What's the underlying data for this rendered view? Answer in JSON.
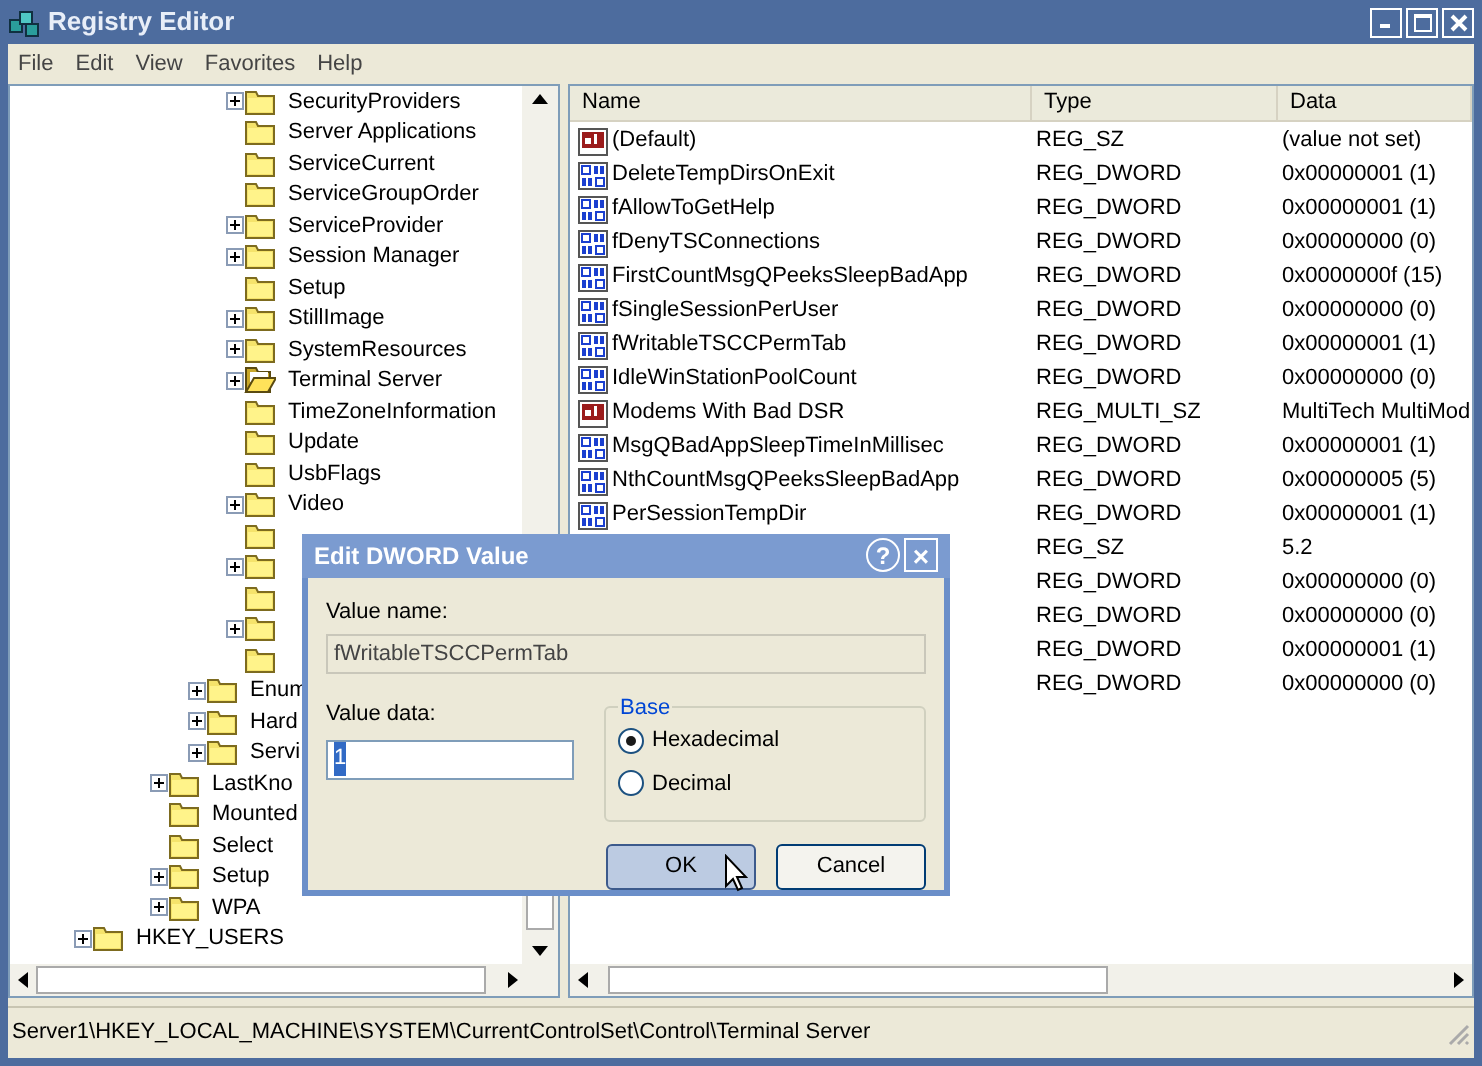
{
  "window": {
    "title": "Registry Editor"
  },
  "menu": [
    "File",
    "Edit",
    "View",
    "Favorites",
    "Help"
  ],
  "tree": [
    {
      "children": [
        {
          "children": [
            {
              "children": [
                {
                  "children": [
                    {
                      "children": [
                        {
                          "label": "SecurityProviders",
                          "expandable": true,
                          "selected": false
                        },
                        {
                          "label": "Server Applications",
                          "expandable": false,
                          "selected": false
                        },
                        {
                          "label": "ServiceCurrent",
                          "expandable": false,
                          "selected": false
                        },
                        {
                          "label": "ServiceGroupOrder",
                          "expandable": false,
                          "selected": false
                        },
                        {
                          "label": "ServiceProvider",
                          "expandable": true,
                          "selected": false
                        },
                        {
                          "label": "Session Manager",
                          "expandable": true,
                          "selected": false
                        },
                        {
                          "label": "Setup",
                          "expandable": false,
                          "selected": false
                        },
                        {
                          "label": "StillImage",
                          "expandable": true,
                          "selected": false
                        },
                        {
                          "label": "SystemResources",
                          "expandable": true,
                          "selected": false
                        },
                        {
                          "label": "Terminal Server",
                          "expandable": true,
                          "selected": true
                        },
                        {
                          "label": "TimeZoneInformation",
                          "expandable": false,
                          "selected": false
                        },
                        {
                          "label": "Update",
                          "expandable": false,
                          "selected": false
                        },
                        {
                          "label": "UsbFlags",
                          "expandable": false,
                          "selected": false
                        },
                        {
                          "label": "Video",
                          "expandable": true,
                          "selected": false
                        },
                        {
                          "expandable": false
                        },
                        {
                          "expandable": true
                        },
                        {
                          "expandable": false
                        },
                        {
                          "expandable": true
                        },
                        {
                          "expandable": false
                        }
                      ]
                    },
                    {
                      "label": "Enum",
                      "expandable": true,
                      "selected": false
                    },
                    {
                      "label": "Hard",
                      "expandable": true,
                      "selected": false
                    },
                    {
                      "label": "Servi",
                      "expandable": true,
                      "selected": false
                    }
                  ]
                },
                {
                  "label": "LastKno",
                  "expandable": true,
                  "selected": false
                },
                {
                  "label": "Mounted",
                  "expandable": false,
                  "selected": false
                },
                {
                  "label": "Select",
                  "expandable": false,
                  "selected": false
                },
                {
                  "label": "Setup",
                  "expandable": true,
                  "selected": false
                },
                {
                  "label": "WPA",
                  "expandable": true,
                  "selected": false
                }
              ]
            }
          ]
        },
        {
          "label": "HKEY_USERS",
          "expandable": true,
          "selected": false
        }
      ]
    }
  ],
  "list": {
    "columns": [
      "Name",
      "Type",
      "Data"
    ],
    "rows": [
      {
        "kind": "string",
        "name": "(Default)",
        "type": "REG_SZ",
        "data": "(value not set)"
      },
      {
        "kind": "binary",
        "name": "DeleteTempDirsOnExit",
        "type": "REG_DWORD",
        "data": "0x00000001 (1)"
      },
      {
        "kind": "binary",
        "name": "fAllowToGetHelp",
        "type": "REG_DWORD",
        "data": "0x00000001 (1)"
      },
      {
        "kind": "binary",
        "name": "fDenyTSConnections",
        "type": "REG_DWORD",
        "data": "0x00000000 (0)"
      },
      {
        "kind": "binary",
        "name": "FirstCountMsgQPeeksSleepBadApp",
        "type": "REG_DWORD",
        "data": "0x0000000f (15)"
      },
      {
        "kind": "binary",
        "name": "fSingleSessionPerUser",
        "type": "REG_DWORD",
        "data": "0x00000000 (0)"
      },
      {
        "kind": "binary",
        "name": "fWritableTSCCPermTab",
        "type": "REG_DWORD",
        "data": "0x00000001 (1)"
      },
      {
        "kind": "binary",
        "name": "IdleWinStationPoolCount",
        "type": "REG_DWORD",
        "data": "0x00000000 (0)"
      },
      {
        "kind": "string",
        "name": "Modems With Bad DSR",
        "type": "REG_MULTI_SZ",
        "data": "MultiTech MultiMod"
      },
      {
        "kind": "binary",
        "name": "MsgQBadAppSleepTimeInMillisec",
        "type": "REG_DWORD",
        "data": "0x00000001 (1)"
      },
      {
        "kind": "binary",
        "name": "NthCountMsgQPeeksSleepBadApp",
        "type": "REG_DWORD",
        "data": "0x00000005 (5)"
      },
      {
        "kind": "binary",
        "name": "PerSessionTempDir",
        "type": "REG_DWORD",
        "data": "0x00000001 (1)"
      },
      {
        "type": "REG_SZ",
        "data": "5.2"
      },
      {
        "type": "REG_DWORD",
        "data": "0x00000000 (0)"
      },
      {
        "type": "REG_DWORD",
        "data": "0x00000000 (0)"
      },
      {
        "type": "REG_DWORD",
        "data": "0x00000001 (1)"
      },
      {
        "type": "REG_DWORD",
        "data": "0x00000000 (0)"
      }
    ]
  },
  "status_bar": "Server1\\HKEY_LOCAL_MACHINE\\SYSTEM\\CurrentControlSet\\Control\\Terminal Server",
  "dialog": {
    "title": "Edit DWORD Value",
    "help": "?",
    "close": "×",
    "value_name_label": "Value name:",
    "value_name": "fWritableTSCCPermTab",
    "value_data_label": "Value data:",
    "value_data": "1",
    "base_label": "Base",
    "radios": [
      {
        "label": "Hexadecimal",
        "selected": true
      },
      {
        "label": "Decimal",
        "selected": false
      }
    ],
    "buttons": [
      {
        "label": "OK",
        "focused": true
      },
      {
        "label": "Cancel",
        "focused": false
      }
    ]
  }
}
